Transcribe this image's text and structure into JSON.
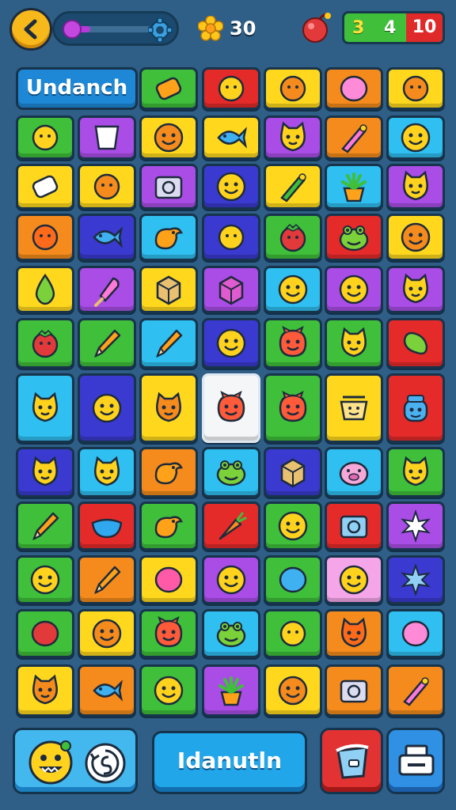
{
  "hud": {
    "coins": "30",
    "moves_yellow": "3",
    "moves_white": "4",
    "target": "10",
    "progress": 0.2
  },
  "board": {
    "title": "Undanch",
    "rows": [
      [
        null,
        "green",
        "red",
        "yellow",
        "orange",
        "yellow"
      ],
      [
        "green",
        "purple",
        "yellow",
        "yellow",
        "purple",
        "orange",
        "cyan"
      ],
      [
        "yellow",
        "yellow",
        "purple",
        "blue",
        "yellow",
        "cyan",
        "purple"
      ],
      [
        "orange",
        "blue",
        "cyan",
        "blue",
        "green",
        "red",
        "yellow"
      ],
      [
        "yellow",
        "purple",
        "yellow",
        "purple",
        "cyan",
        "purple",
        "purple"
      ],
      [
        "green",
        "green",
        "cyan",
        "blue",
        "green",
        "green",
        "red"
      ],
      [
        "cyan",
        "blue",
        "yellow",
        "white",
        "green",
        "yellow",
        "red"
      ],
      [
        "blue",
        "cyan",
        "orange",
        "cyan",
        "blue",
        "cyan",
        "green"
      ],
      [
        "green",
        "red",
        "green",
        "red",
        "green",
        "red",
        "purple"
      ],
      [
        "green",
        "orange",
        "yellow",
        "purple",
        "green",
        "pink",
        "blue"
      ],
      [
        "green",
        "yellow",
        "green",
        "cyan",
        "green",
        "orange",
        "cyan"
      ],
      [
        "yellow",
        "orange",
        "green",
        "purple",
        "yellow",
        "orange",
        "orange"
      ]
    ],
    "icons": [
      [
        null,
        "candy-icon",
        "bug-icon",
        "burger-icon",
        "blob-icon",
        "shell-icon"
      ],
      [
        "bow-icon",
        "cup-icon",
        "face-icon",
        "fish-icon",
        "cat-icon",
        "wand-icon",
        "face-icon"
      ],
      [
        "eraser-icon",
        "hat-icon",
        "radio-icon",
        "face-icon",
        "rocket-icon",
        "plant-icon",
        "cat-icon"
      ],
      [
        "cookie-icon",
        "fish-icon",
        "bird-icon",
        "elephant-icon",
        "tomato-icon",
        "frog-icon",
        "face-icon"
      ],
      [
        "drop-icon",
        "popsicle-icon",
        "box-icon",
        "cube-icon",
        "face-icon",
        "face-icon",
        "cat-icon"
      ],
      [
        "tomato-icon",
        "pencil-icon",
        "pencil-icon",
        "face-icon",
        "monster-icon",
        "cat-icon",
        "bean-icon"
      ],
      [
        "cat-icon",
        "face-icon",
        "cat-icon",
        "monster-icon",
        "monster-icon",
        "pot-icon",
        "robot-icon"
      ],
      [
        "cat-icon",
        "cat-icon",
        "bird-icon",
        "frog-icon",
        "box-icon",
        "pig-icon",
        "cat-icon"
      ],
      [
        "pencil-icon",
        "bowl-icon",
        "bird-icon",
        "carrot-icon",
        "face-icon",
        "tv-icon",
        "flower-icon"
      ],
      [
        "face-icon",
        "pencil-icon",
        "bubble-icon",
        "face-icon",
        "balloon-icon",
        "face-icon",
        "star-icon"
      ],
      [
        "ball-icon",
        "face-icon",
        "monster-icon",
        "frog-icon",
        "bug-icon",
        "cat-icon",
        "blob-icon"
      ],
      [
        "cat-icon",
        "fish-icon",
        "face-icon",
        "plant-icon",
        "face-icon",
        "speaker-icon",
        "wand-icon"
      ]
    ]
  },
  "bottom": {
    "main_label": "Idanutln"
  },
  "colors": {
    "green": "#3fbf3a",
    "red": "#e52a2a",
    "yellow": "#ffd81e",
    "orange": "#f58b1c",
    "purple": "#a94de6",
    "cyan": "#2fbff0",
    "blue": "#3a3ad0",
    "pink": "#f4a6e8",
    "white": "#f4f6f8"
  }
}
